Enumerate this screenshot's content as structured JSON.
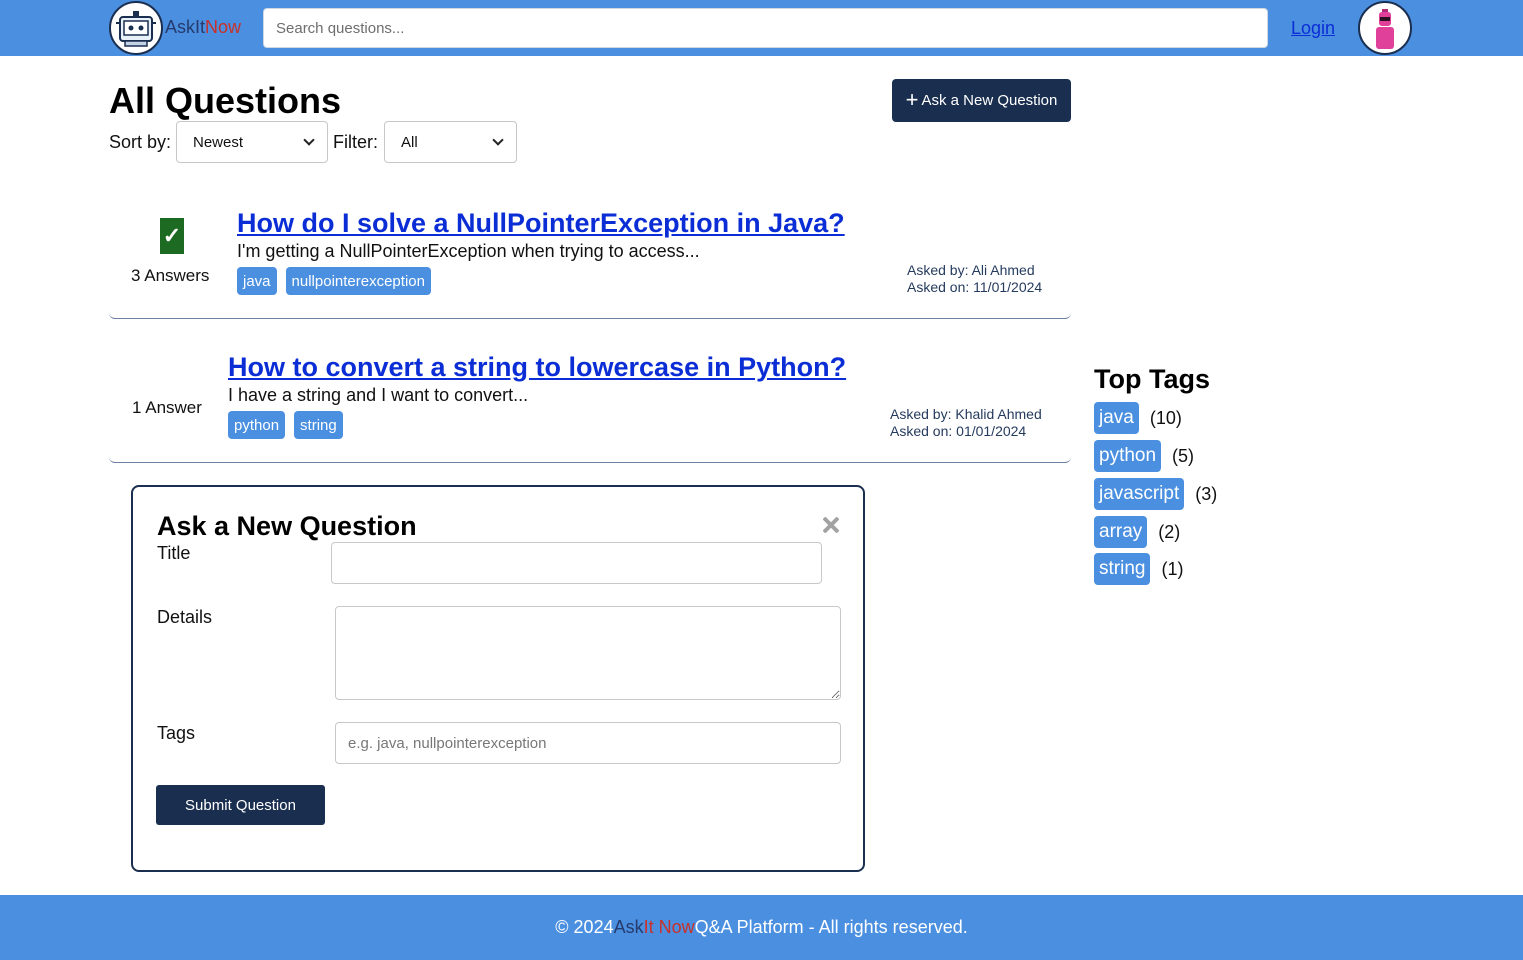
{
  "header": {
    "brand_part1": "AskIt",
    "brand_part2": "Now",
    "search_placeholder": "Search questions...",
    "login_label": "Login",
    "colors": {
      "bar": "#4a8fe0",
      "navy": "#1a2e4f",
      "brand_red": "#c8312a"
    }
  },
  "main": {
    "title": "All Questions",
    "ask_button_label": "Ask a New Question",
    "sort_label": "Sort by:",
    "sort_value": "Newest",
    "filter_label": "Filter:",
    "filter_value": "All"
  },
  "questions": [
    {
      "answered": true,
      "answers": "3 Answers",
      "title": "How do I solve a NullPointerException in Java?",
      "snippet": "I'm getting a NullPointerException when trying to access...",
      "tags": [
        "java",
        "nullpointerexception"
      ],
      "asked_by": "Asked by: Ali Ahmed",
      "asked_on": "Asked on: 11/01/2024"
    },
    {
      "answered": false,
      "answers": "1 Answer",
      "title": "How to convert a string to lowercase in Python?",
      "snippet": "I have a string and I want to convert...",
      "tags": [
        "python",
        "string"
      ],
      "asked_by": "Asked by: Khalid Ahmed",
      "asked_on": "Asked on: 01/01/2024"
    }
  ],
  "top_tags": {
    "title": "Top Tags",
    "items": [
      {
        "name": "java",
        "count": "(10)"
      },
      {
        "name": "python",
        "count": "(5)"
      },
      {
        "name": "javascript",
        "count": "(3)"
      },
      {
        "name": "array",
        "count": "(2)"
      },
      {
        "name": "string",
        "count": "(1)"
      }
    ]
  },
  "modal": {
    "title": "Ask a New Question",
    "title_label": "Title",
    "title_value": "",
    "details_label": "Details",
    "details_value": "",
    "tags_label": "Tags",
    "tags_placeholder": "e.g. java, nullpointerexception",
    "submit_label": "Submit Question"
  },
  "footer": {
    "prefix": "© 2024 ",
    "brand_ask": "Ask ",
    "brand_it_now": "It Now",
    "suffix": " Q&A Platform - All rights reserved."
  }
}
